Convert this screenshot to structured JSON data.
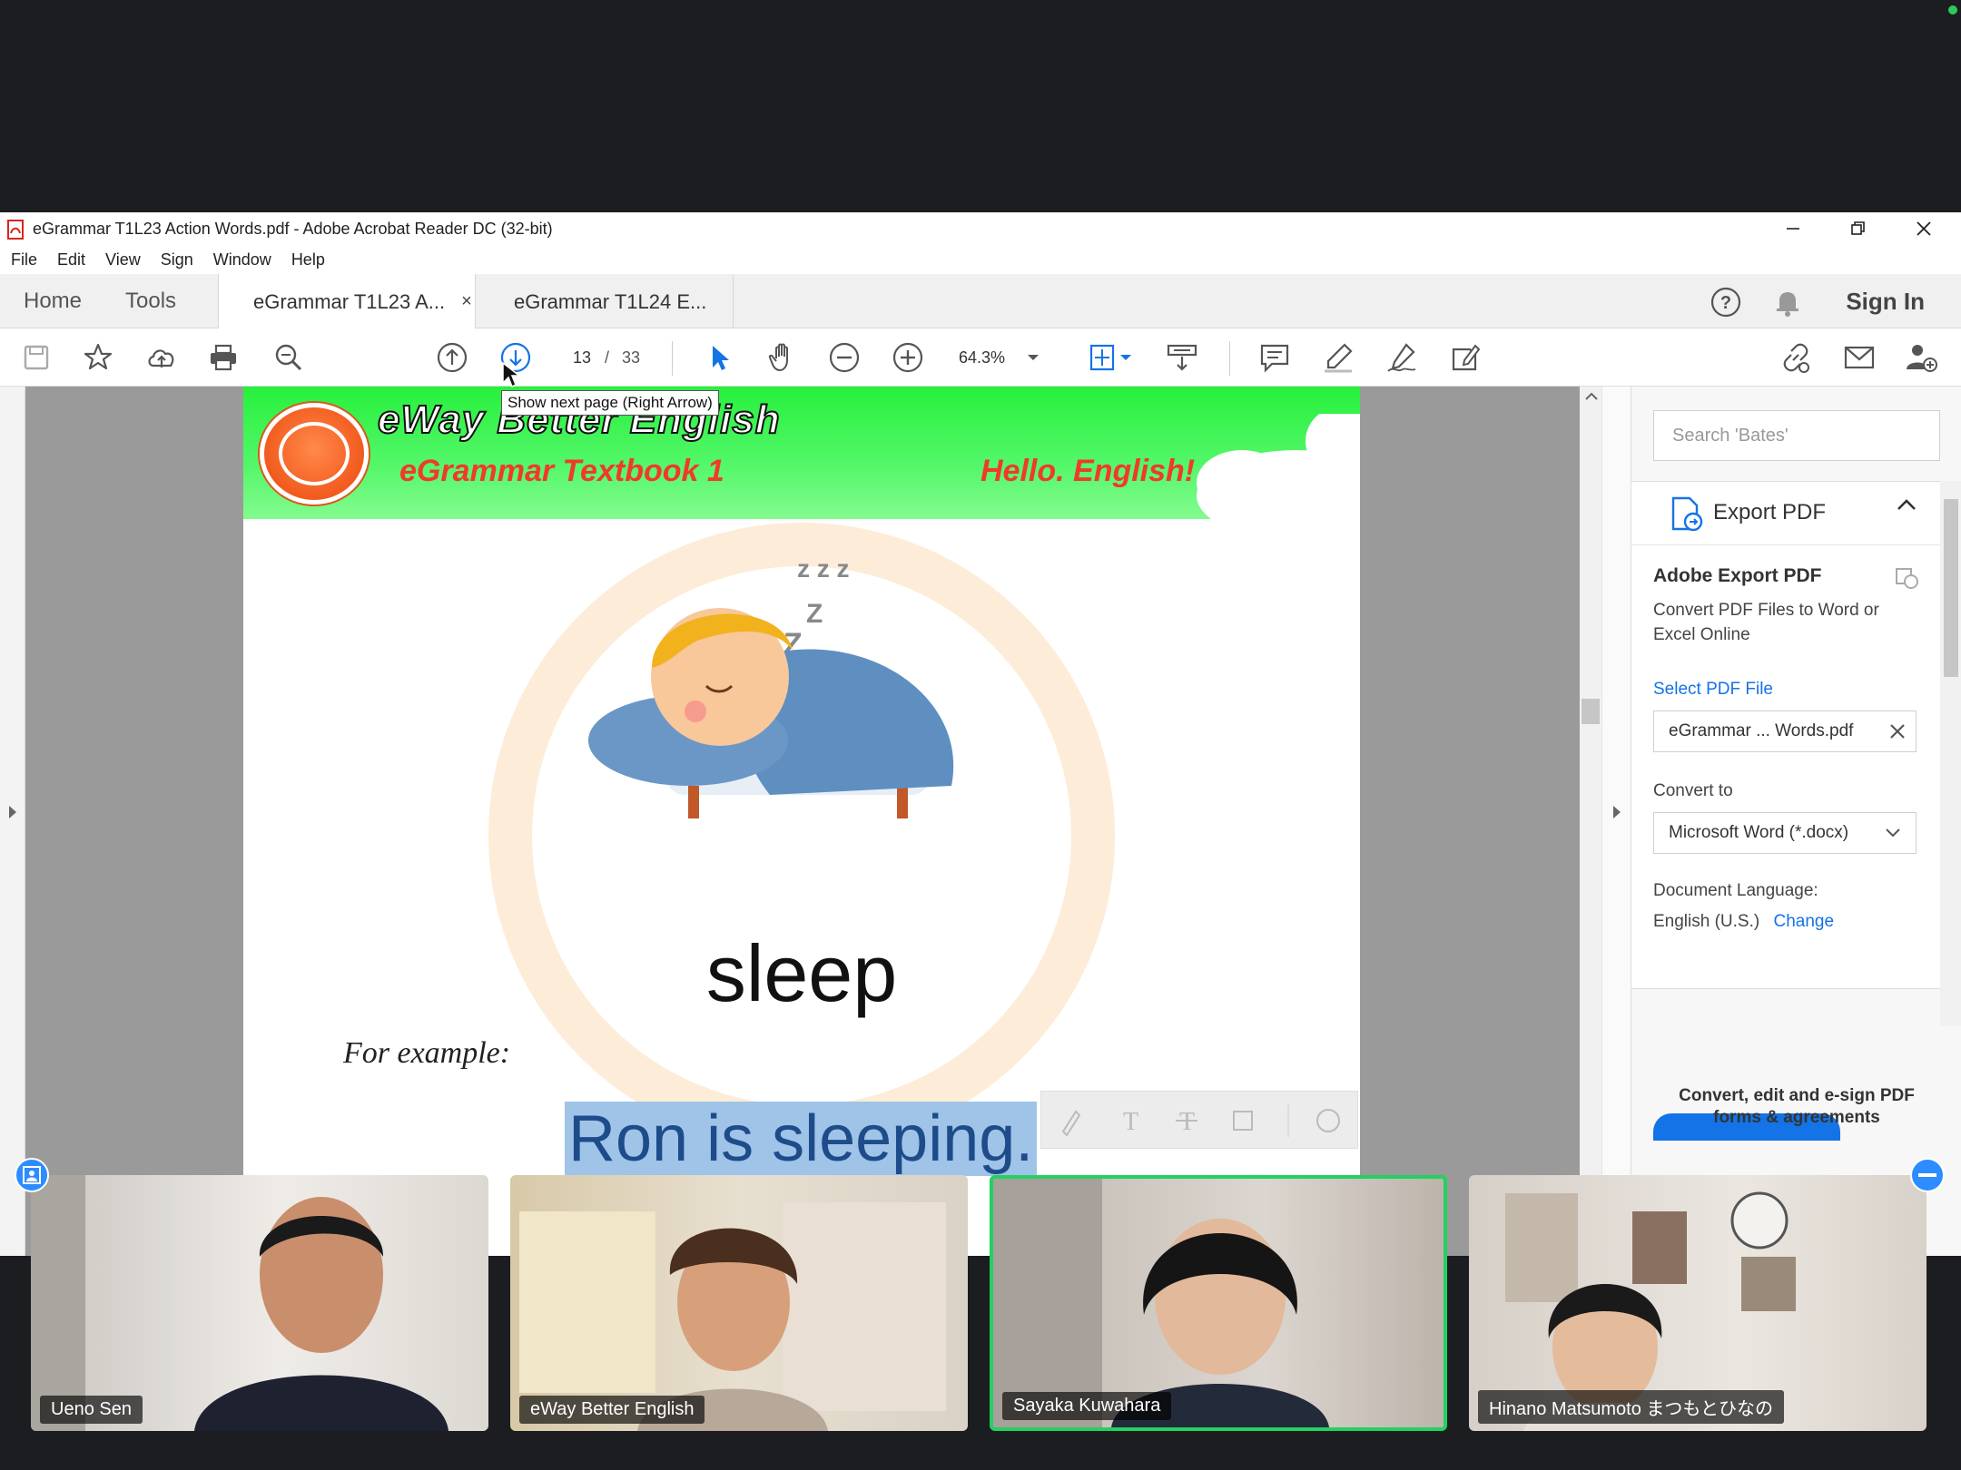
{
  "window": {
    "title": "eGrammar T1L23 Action Words.pdf - Adobe Acrobat Reader DC (32-bit)"
  },
  "menu": [
    "File",
    "Edit",
    "View",
    "Sign",
    "Window",
    "Help"
  ],
  "nav_tabs": {
    "home": "Home",
    "tools": "Tools"
  },
  "doc_tabs": [
    {
      "label": "eGrammar T1L23 A...",
      "close": "×"
    },
    {
      "label": "eGrammar T1L24 E..."
    }
  ],
  "header": {
    "sign_in": "Sign In"
  },
  "toolbar": {
    "page_current": "13",
    "page_sep": "/",
    "page_total": "33",
    "zoom": "64.3%"
  },
  "tooltip": "Show next page (Right Arrow)",
  "pdf_page": {
    "brand": "eWay Better English",
    "subtitle": "eGrammar Textbook 1",
    "greeting": "Hello. English!",
    "word": "sleep",
    "example_label": "For example:",
    "sentence": "Ron is sleeping."
  },
  "right_panel": {
    "search_placeholder": "Search 'Bates'",
    "export_header": "Export PDF",
    "title": "Adobe Export PDF",
    "description": "Convert PDF Files to Word or Excel Online",
    "select_file": "Select PDF File",
    "file_name": "eGrammar ... Words.pdf",
    "convert_to_label": "Convert to",
    "convert_to_value": "Microsoft Word (*.docx)",
    "doc_language_label": "Document Language:",
    "doc_language_value": "English (U.S.)",
    "change_link": "Change",
    "promo": "Convert, edit and e-sign PDF forms & agreements"
  },
  "participants": [
    {
      "name": "Ueno Sen"
    },
    {
      "name": "eWay Better English"
    },
    {
      "name": "Sayaka Kuwahara",
      "speaking": true
    },
    {
      "name": "Hinano Matsumoto まつもとひなの"
    }
  ],
  "colors": {
    "accent": "#1473e6",
    "speaking_border": "#23d160",
    "banner_green": "#27f03c",
    "subtitle_red": "#f03a2a"
  }
}
